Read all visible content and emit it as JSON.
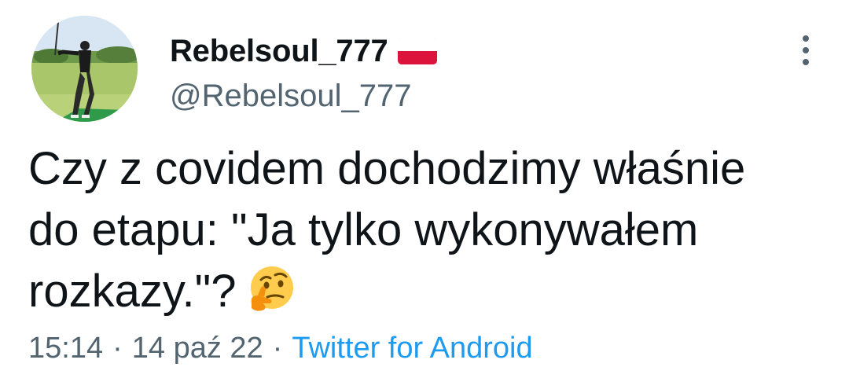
{
  "author": {
    "display_name": "Rebelsoul_777",
    "handle": "@Rebelsoul_777",
    "flag_icon": "poland-flag-icon",
    "avatar": "golfer-avatar"
  },
  "tweet": {
    "lines": [
      "Czy z covidem dochodzimy właśnie",
      "do etapu: \"Ja tylko wykonywałem",
      "rozkazy.\"?"
    ],
    "emoji_icon": "thinking-face-icon"
  },
  "meta": {
    "time": "15:14",
    "date": "14 paź 22",
    "separator": "·",
    "source": "Twitter for Android"
  },
  "icons": {
    "more": "more-options-icon"
  },
  "colors": {
    "text": "#0f1419",
    "secondary": "#536471",
    "link": "#1d9bf0",
    "flag_white": "#ffffff",
    "flag_red": "#dc143c"
  }
}
